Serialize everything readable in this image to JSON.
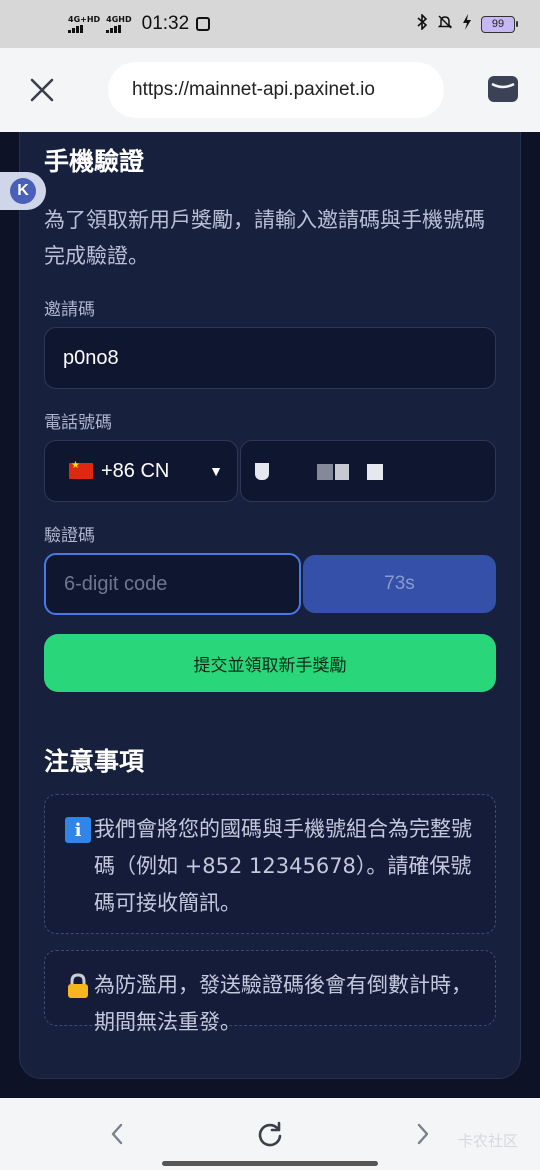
{
  "status_bar": {
    "network_1": "4G+HD",
    "network_2": "4GHD",
    "time": "01:32",
    "battery": "99"
  },
  "browser": {
    "url": "https://mainnet-api.paxinet.io",
    "icons": {
      "close": "close-icon",
      "wallet": "wallet-icon"
    }
  },
  "float_badge": {
    "letter": "K"
  },
  "verify": {
    "title": "手機驗證",
    "intro": "為了領取新用戶獎勵，請輸入邀請碼與手機號碼完成驗證。",
    "invite_label": "邀請碼",
    "invite_value": "p0no8",
    "phone_label": "電話號碼",
    "country_value": "+86 CN",
    "code_label": "驗證碼",
    "code_placeholder": "6-digit code",
    "resend_label": "73s",
    "submit_label": "提交並領取新手獎勵"
  },
  "notes": {
    "title": "注意事項",
    "items": [
      {
        "icon": "info-icon",
        "icon_text": "i",
        "text": "我們會將您的國碼與手機號組合為完整號碼（例如 +852 12345678）。請確保號碼可接收簡訊。"
      },
      {
        "icon": "lock-icon",
        "icon_text": "",
        "text": "為防濫用，發送驗證碼後會有倒數計時，期間無法重發。"
      }
    ]
  },
  "bottom_nav": {
    "icons": [
      "back-icon",
      "reload-icon",
      "forward-icon"
    ],
    "watermark": "卡农社区"
  }
}
